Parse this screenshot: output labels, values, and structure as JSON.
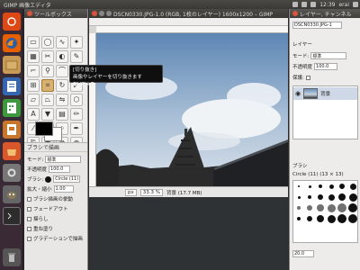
{
  "top_panel": {
    "title": "GIMP 画像エディタ",
    "time": "12:39",
    "user": "erai"
  },
  "launcher": {
    "items": [
      "ubuntu-logo",
      "firefox",
      "files",
      "libreoffice-writer",
      "libreoffice-calc",
      "libreoffice-impress",
      "ubuntu-software",
      "system-settings",
      "gimp",
      "terminal",
      "trash"
    ]
  },
  "toolbox": {
    "title": "ツールボックス",
    "tools": [
      "rect-select",
      "ellipse-select",
      "free-select",
      "fuzzy-select",
      "by-color-select",
      "scissors",
      "foreground-select",
      "paths",
      "color-picker",
      "zoom",
      "measure",
      "move",
      "align",
      "crop",
      "rotate",
      "scale",
      "shear",
      "perspective",
      "flip",
      "cage",
      "text",
      "bucket-fill",
      "blend",
      "pencil",
      "paintbrush",
      "eraser",
      "airbrush",
      "ink",
      "clone",
      "heal",
      "perspective-clone",
      "blur",
      "smudge",
      "dodge-burn"
    ],
    "active_tool": "crop",
    "options": {
      "title": "ブラシで描画",
      "mode_label": "モード:",
      "mode_value": "標準",
      "opacity_label": "不透明度",
      "opacity_value": "100.0",
      "brush_label": "ブラシ:",
      "brush_value": "Circle (11)",
      "scale_label": "拡大・縮小",
      "scale_value": "1.00",
      "brush_dynamics": "ブラシ描画の挙動",
      "fade_out": "フェードアウト",
      "jitter": "揺らし",
      "smooth": "重ね塗り",
      "incremental": "グラデーションで描画"
    }
  },
  "image_window": {
    "title": "DSCN0330.JPG-1.0 (RGB, 1枚のレイヤー) 1600x1200 – GIMP",
    "unit": "px",
    "zoom": "33.3 %",
    "status": "背景 (17.7 MB)"
  },
  "tooltip": {
    "line1": "[切り抜き]",
    "line2": "画像やレイヤーを切り抜きます",
    "shortcut": "Shift+C"
  },
  "layers_window": {
    "title": "レイヤー, チャンネル",
    "image_select": "DSCN0330.JPG-1",
    "tab_label": "レイヤー",
    "mode_label": "モード:",
    "mode_value": "標準",
    "opacity_label": "不透明度",
    "opacity_value": "100.0",
    "lock_label": "保護:",
    "layer_name": "背景",
    "brush_panel_title": "ブラシ",
    "brush_info": "Circle (11) (13 × 13)",
    "spacing_value": "20.0"
  }
}
